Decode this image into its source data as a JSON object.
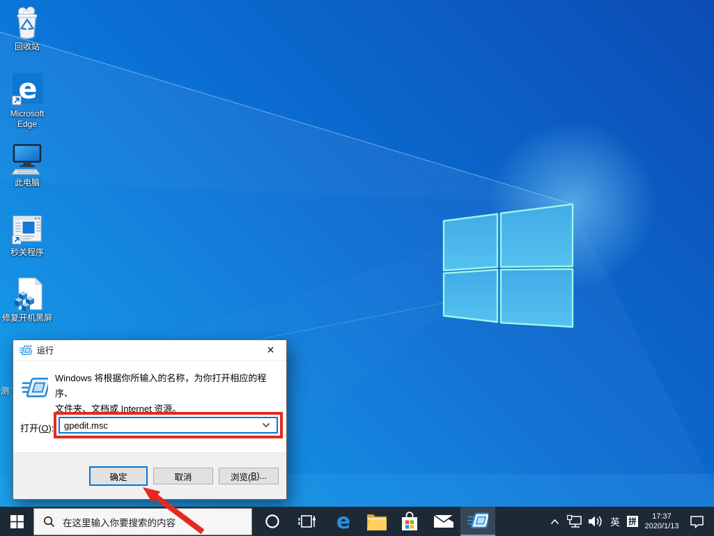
{
  "desktop": {
    "icons": [
      {
        "label": "回收站"
      },
      {
        "label": "Microsoft Edge"
      },
      {
        "label": "此电脑"
      },
      {
        "label": "秒关程序"
      },
      {
        "label": "修复开机黑屏"
      }
    ],
    "partial_label": "测"
  },
  "run_dialog": {
    "title": "运行",
    "description_line1": "Windows 将根据你所输入的名称，为你打开相应的程序、",
    "description_line2": "文件夹、文档或 Internet 资源。",
    "open_label": {
      "prefix": "打开(",
      "key": "O",
      "suffix": "):"
    },
    "input_value": "gpedit.msc",
    "buttons": {
      "ok": "确定",
      "cancel": "取消",
      "browse": {
        "prefix": "浏览(",
        "key": "B",
        "suffix": ")..."
      }
    },
    "icons": {
      "close": "✕"
    }
  },
  "taskbar": {
    "search_placeholder": "在这里输入你要搜索的内容",
    "tray": {
      "ime_lang": "英",
      "ime_mode": "拼",
      "time": "17:37",
      "date": "2020/1/13"
    }
  },
  "colors": {
    "annotation_red": "#e42a1e",
    "accent_blue": "#0078d7",
    "taskbar_bg": "#1d2935",
    "wallpaper_deep": "#0b4fb8",
    "wallpaper_bright": "#0a8ae0"
  }
}
